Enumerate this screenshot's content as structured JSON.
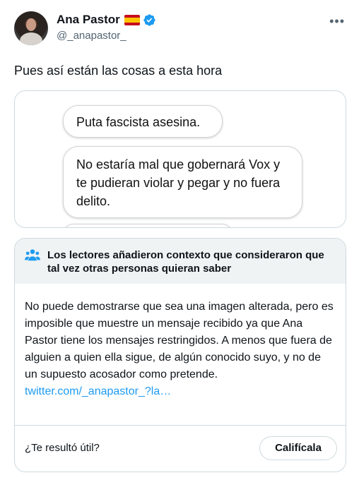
{
  "author": {
    "name": "Ana Pastor",
    "handle": "@_anapastor_",
    "flag_icon": "spain-flag-icon",
    "verified_icon": "verified-badge-icon",
    "more_icon": "more-options-icon"
  },
  "tweet": {
    "text": "Pues así están las cosas a esta hora"
  },
  "media": {
    "messages": [
      "Puta fascista asesina.",
      "No estaría mal que gobernará Vox y te pudieran violar y pegar y no fuera delito."
    ]
  },
  "community_note": {
    "icon": "people-icon",
    "title": "Los lectores añadieron contexto que consideraron que tal vez otras personas quieran saber",
    "body": "No puede demostrarse que sea una imagen alterada, pero es imposible que muestre un mensaje recibido ya que Ana Pastor tiene los mensajes restringidos. A menos que fuera de alguien a quien ella sigue, de algún conocido suyo, y no de un supuesto acosador como pretende.",
    "link": "twitter.com/_anapastor_?la…",
    "helpful_question": "¿Te resultó útil?",
    "rate_button": "Califícala"
  },
  "colors": {
    "accent": "#1d9bf0",
    "text": "#0f1419",
    "secondary": "#536471",
    "border": "#cfd9de",
    "note_header_bg": "#eff3f4"
  }
}
